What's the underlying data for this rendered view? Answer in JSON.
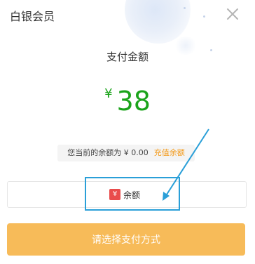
{
  "dialog": {
    "title": "白银会员",
    "close_icon": "close-icon"
  },
  "payment": {
    "amount_label": "支付金额",
    "currency_symbol": "¥",
    "amount": "38",
    "balance_text": "您当前的余额为 ¥ 0.00",
    "recharge_link": "充值余额"
  },
  "pay_methods": [
    {
      "icon": "yen-icon",
      "label": "余额"
    }
  ],
  "submit_label": "请选择支付方式",
  "colors": {
    "amount": "#1aa31a",
    "recharge": "#f39a1a",
    "submit_bg": "#f7bb59",
    "highlight": "#2a9fd8",
    "badge": "#e94c4c"
  }
}
